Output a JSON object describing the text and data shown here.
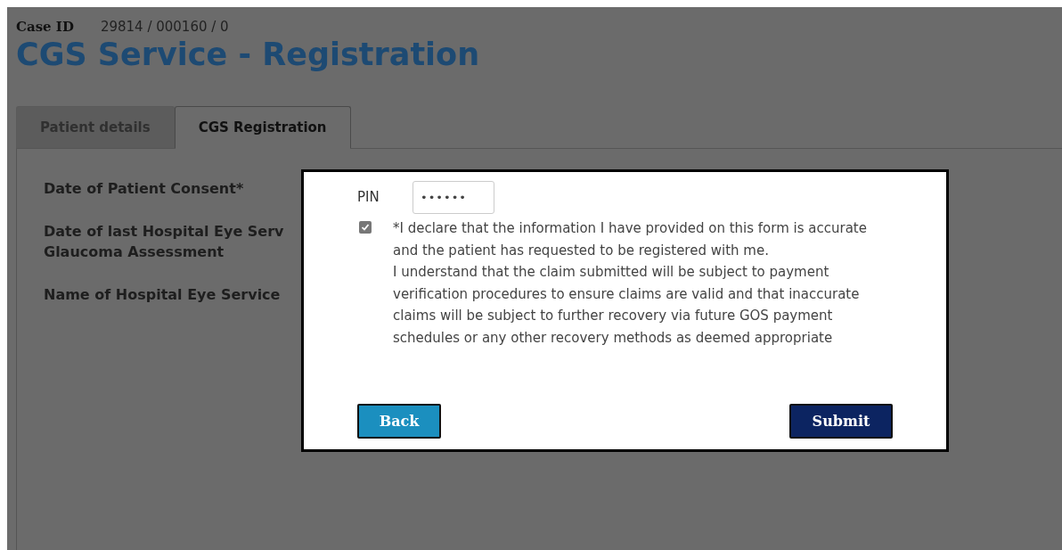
{
  "case": {
    "label": "Case ID",
    "value": "29814 / 000160 / 0"
  },
  "title": "CGS Service - Registration",
  "tabs": [
    {
      "label": "Patient details",
      "selected": false
    },
    {
      "label": "CGS Registration",
      "selected": true
    }
  ],
  "form_labels": [
    [
      "Date of Patient Consent*"
    ],
    [
      "Date of last Hospital Eye Serv",
      "Glaucoma Assessment"
    ],
    [
      "Name of Hospital Eye Service"
    ]
  ],
  "dialog": {
    "pin": {
      "label": "PIN",
      "value": "••••••"
    },
    "declaration": {
      "checked": true,
      "lines": [
        "*I declare that the information I have provided on this form is accurate and the patient has requested to be registered with me.",
        "I understand that the claim submitted will be subject to payment verification procedures to ensure claims are valid and that inaccurate claims will be subject to further recovery via future GOS payment schedules or any other recovery methods as deemed appropriate"
      ]
    },
    "buttons": [
      {
        "label": "Back",
        "kind": "secondary"
      },
      {
        "label": "Submit",
        "kind": "primary"
      }
    ]
  }
}
